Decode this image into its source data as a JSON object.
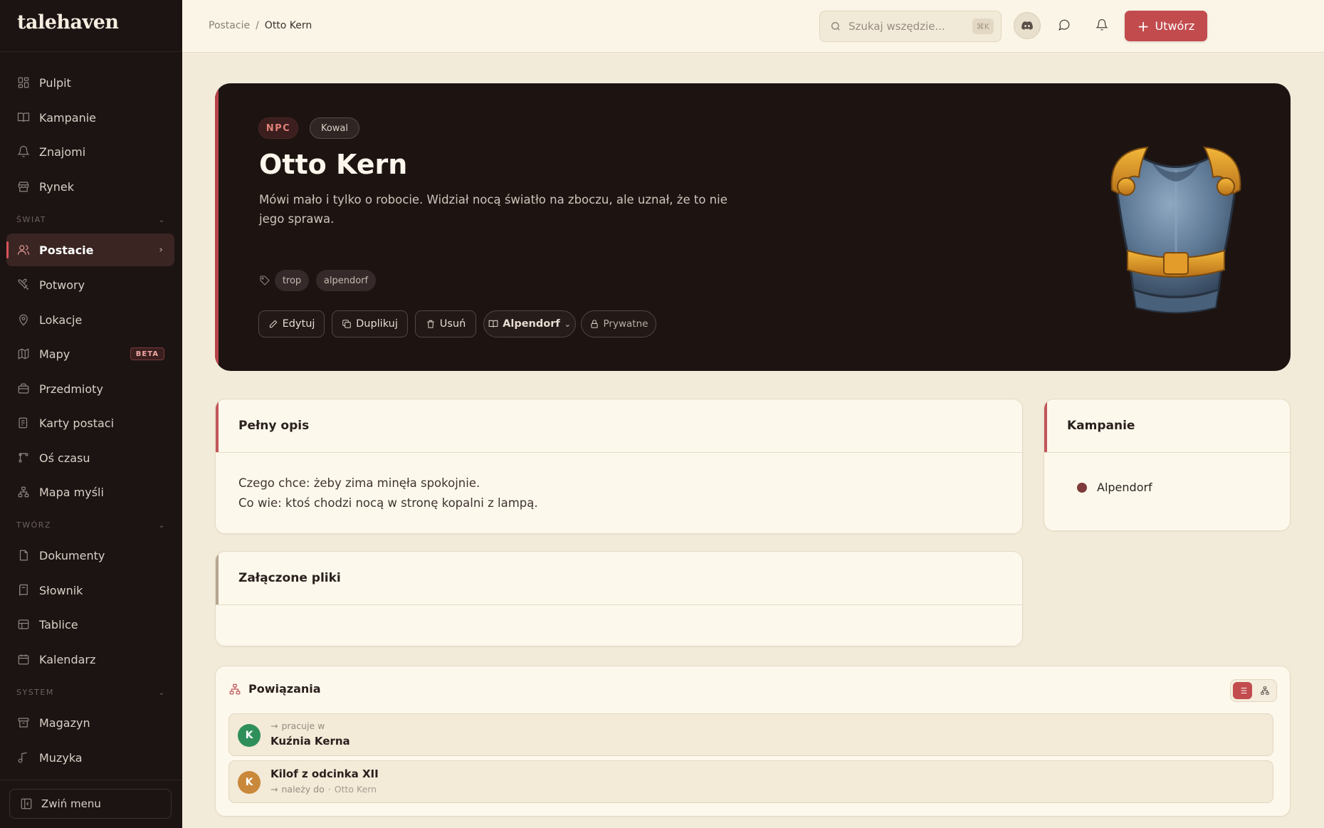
{
  "app": {
    "logo": "talehaven"
  },
  "sidebar": {
    "top_items": [
      {
        "label": "Pulpit",
        "icon": "dashboard-icon"
      },
      {
        "label": "Kampanie",
        "icon": "book-icon"
      },
      {
        "label": "Znajomi",
        "icon": "bell-icon"
      },
      {
        "label": "Rynek",
        "icon": "store-icon"
      }
    ],
    "sections": {
      "world": "ŚWIAT",
      "create": "TWÓRZ",
      "system": "SYSTEM"
    },
    "world_items": [
      {
        "label": "Postacie",
        "icon": "users-icon",
        "active": true
      },
      {
        "label": "Potwory",
        "icon": "swords-icon"
      },
      {
        "label": "Lokacje",
        "icon": "map-pin-icon"
      },
      {
        "label": "Mapy",
        "icon": "map-icon",
        "badge": "BETA"
      },
      {
        "label": "Przedmioty",
        "icon": "box-icon"
      },
      {
        "label": "Karty postaci",
        "icon": "sheet-icon"
      },
      {
        "label": "Oś czasu",
        "icon": "timeline-icon"
      },
      {
        "label": "Mapa myśli",
        "icon": "mindmap-icon"
      }
    ],
    "create_items": [
      {
        "label": "Dokumenty",
        "icon": "document-icon"
      },
      {
        "label": "Słownik",
        "icon": "dictionary-icon"
      },
      {
        "label": "Tablice",
        "icon": "table-icon"
      },
      {
        "label": "Kalendarz",
        "icon": "calendar-icon"
      }
    ],
    "system_items": [
      {
        "label": "Magazyn",
        "icon": "archive-icon"
      },
      {
        "label": "Muzyka",
        "icon": "music-icon"
      }
    ],
    "collapse_label": "Zwiń menu"
  },
  "topbar": {
    "breadcrumb": [
      "Postacie",
      "Otto Kern"
    ],
    "breadcrumb_sep": "/",
    "search_placeholder": "Szukaj wszędzie...",
    "search_shortcut": "⌘K",
    "create_label": "Utwórz"
  },
  "hero": {
    "type_chip": "NPC",
    "role_chip": "Kowal",
    "name": "Otto Kern",
    "description": "Mówi mało i tylko o robocie. Widział nocą światło na zboczu, ale uznał, że to nie jego sprawa.",
    "tags": [
      "trop",
      "alpendorf"
    ],
    "actions": {
      "edit": "Edytuj",
      "duplicate": "Duplikuj",
      "delete": "Usuń",
      "campaign": "Alpendorf",
      "privacy": "Prywatne"
    },
    "image": "breastplate-armor-illustration"
  },
  "full_description": {
    "title": "Pełny opis",
    "lines": [
      "Czego chce: żeby zima minęła spokojnie.",
      "Co wie: ktoś chodzi nocą w stronę kopalni z lampą."
    ]
  },
  "attachments": {
    "title": "Załączone pliki"
  },
  "campaigns": {
    "title": "Kampanie",
    "items": [
      {
        "name": "Alpendorf",
        "color": "#7e3b3c"
      }
    ]
  },
  "relations": {
    "title": "Powiązania",
    "items": [
      {
        "avatar": "K",
        "avatar_color": "#2f8f5b",
        "relation": "pracuje w",
        "name": "Kuźnia Kerna"
      },
      {
        "avatar": "K",
        "avatar_color": "#c9883a",
        "relation": "należy do",
        "owner": "Otto Kern",
        "name": "Kilof z odcinka XII"
      }
    ]
  },
  "colors": {
    "accent": "#c24b4e",
    "sidebar_bg": "#1c1413",
    "hero_bg": "#1d1412",
    "page_bg": "#f3ebd9"
  }
}
